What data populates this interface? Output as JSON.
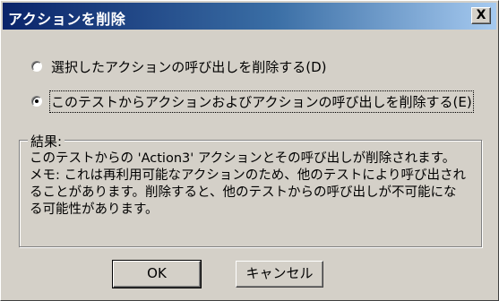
{
  "dialog": {
    "title": "アクションを削除",
    "close_label": "X"
  },
  "options": [
    {
      "label": "選択したアクションの呼び出しを削除する(D)",
      "checked": false
    },
    {
      "label": "このテストからアクションおよびアクションの呼び出しを削除する(E)",
      "checked": true
    }
  ],
  "result_group": {
    "title": "結果:",
    "message": "このテストからの 'Action3' アクションとその呼び出しが削除されます。",
    "note": "メモ: これは再利用可能なアクションのため、他のテストにより呼び出されることがあります。削除すると、他のテストからの呼び出しが不可能になる可能性があります。"
  },
  "buttons": {
    "ok_label": "OK",
    "cancel_label": "キャンセル"
  }
}
